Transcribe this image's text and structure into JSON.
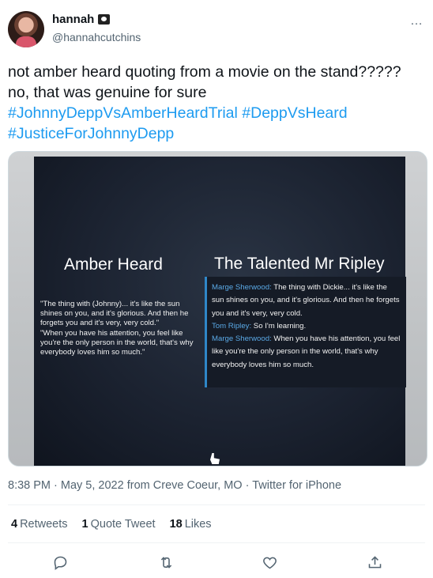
{
  "user": {
    "name": "hannah",
    "name_emoji": "pirate-flag-icon",
    "handle": "@hannahcutchins"
  },
  "more_icon": "…",
  "tweet": {
    "text_plain": "not amber heard quoting from a movie on the stand????? no, that was genuine for sure",
    "hashtags": [
      "#JohnnyDeppVsAmberHeardTrial",
      "#DeppVsHeard",
      "#JusticeForJohnnyDepp"
    ]
  },
  "media": {
    "left_title": "Amber Heard",
    "right_title": "The Talented Mr Ripley",
    "left_quote_1": "\"The thing with (Johnny)... it's like the sun shines on you, and it's glorious. And then he forgets you and it's very, very cold.\"",
    "left_quote_2": "\"When you have his attention, you feel like you're the only person in the world, that's why everybody loves him so much.\"",
    "right_lines": [
      {
        "speaker": "Marge Sherwood:",
        "text": " The thing with Dickie... it's like the sun shines on you, and it's glorious. And then he forgets you and it's very, very cold."
      },
      {
        "speaker": "Tom Ripley:",
        "text": " So I'm learning."
      },
      {
        "speaker": "Marge Sherwood:",
        "text": " When you have his attention, you feel like you're the only person in the world, that's why everybody loves him so much."
      }
    ]
  },
  "meta": {
    "time": "8:38 PM",
    "date": "May 5, 2022",
    "location": "from Creve Coeur, MO",
    "source": "Twitter for iPhone",
    "separator": " · "
  },
  "stats": {
    "retweets_count": "4",
    "retweets_label": "Retweets",
    "quotes_count": "1",
    "quotes_label": "Quote Tweet",
    "likes_count": "18",
    "likes_label": "Likes"
  },
  "actions": [
    "reply-icon",
    "retweet-icon",
    "like-icon",
    "share-icon"
  ],
  "colors": {
    "link": "#1d9bf0",
    "secondary_text": "#536471",
    "primary_text": "#0f1419"
  }
}
